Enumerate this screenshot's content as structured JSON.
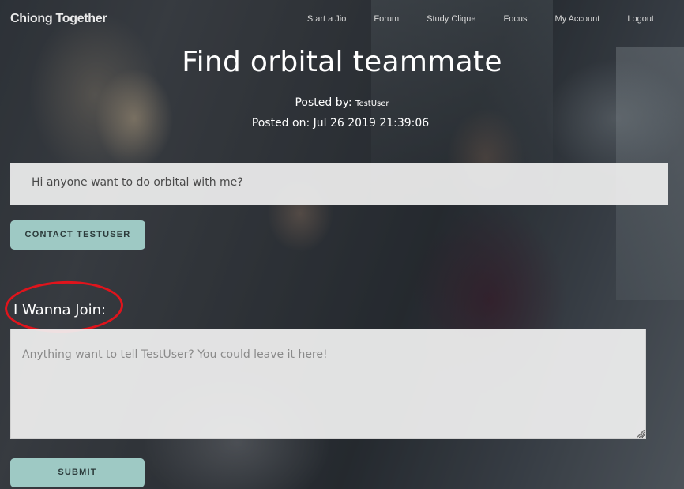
{
  "nav": {
    "brand": "Chiong Together",
    "links": [
      "Start a Jio",
      "Forum",
      "Study Clique",
      "Focus",
      "My Account",
      "Logout"
    ]
  },
  "post": {
    "title": "Find orbital teammate",
    "posted_by_label": "Posted by:",
    "posted_by_user": "TestUser",
    "posted_on": "Posted on: Jul 26 2019 21:39:06",
    "message": "Hi anyone want to do orbital with me?"
  },
  "contact_button": "CONTACT TESTUSER",
  "join": {
    "label": "I Wanna Join:",
    "placeholder": "Anything want to tell TestUser? You could leave it here!",
    "submit": "SUBMIT"
  },
  "colors": {
    "button_bg": "#9ec9c4",
    "annotation": "#e0141c"
  }
}
